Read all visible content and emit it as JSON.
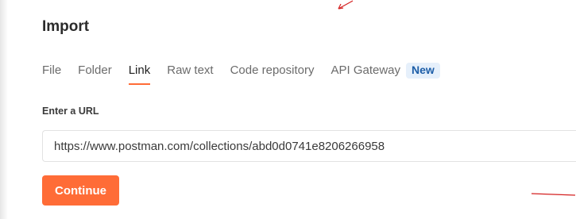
{
  "dialog": {
    "title": "Import"
  },
  "tabs": [
    {
      "label": "File",
      "active": false
    },
    {
      "label": "Folder",
      "active": false
    },
    {
      "label": "Link",
      "active": true
    },
    {
      "label": "Raw text",
      "active": false
    },
    {
      "label": "Code repository",
      "active": false
    },
    {
      "label": "API Gateway",
      "active": false,
      "badge": "New"
    }
  ],
  "url_field": {
    "label": "Enter a URL",
    "value": "https://www.postman.com/collections/abd0d0741e8206266958"
  },
  "actions": {
    "continue_label": "Continue"
  },
  "colors": {
    "accent": "#ff6c37",
    "badge_text": "#1d5ea8",
    "badge_bg": "#e6f0fb",
    "annotation": "#d42020"
  }
}
